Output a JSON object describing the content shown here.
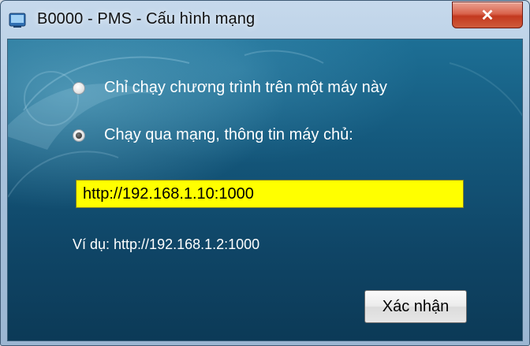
{
  "window": {
    "title": "B0000 - PMS - Cấu hình mạng",
    "close_glyph": "✕"
  },
  "options": [
    {
      "label": "Chỉ chạy chương trình trên một máy này",
      "checked": false
    },
    {
      "label": "Chạy qua mạng, thông tin máy chủ:",
      "checked": true
    }
  ],
  "server": {
    "url": "http://192.168.1.10:1000",
    "example": "Ví dụ: http://192.168.1.2:1000"
  },
  "confirm_label": "Xác nhận",
  "colors": {
    "input_bg": "#ffff00",
    "client_bg": "#14587c",
    "close_btn": "#c3391f"
  }
}
